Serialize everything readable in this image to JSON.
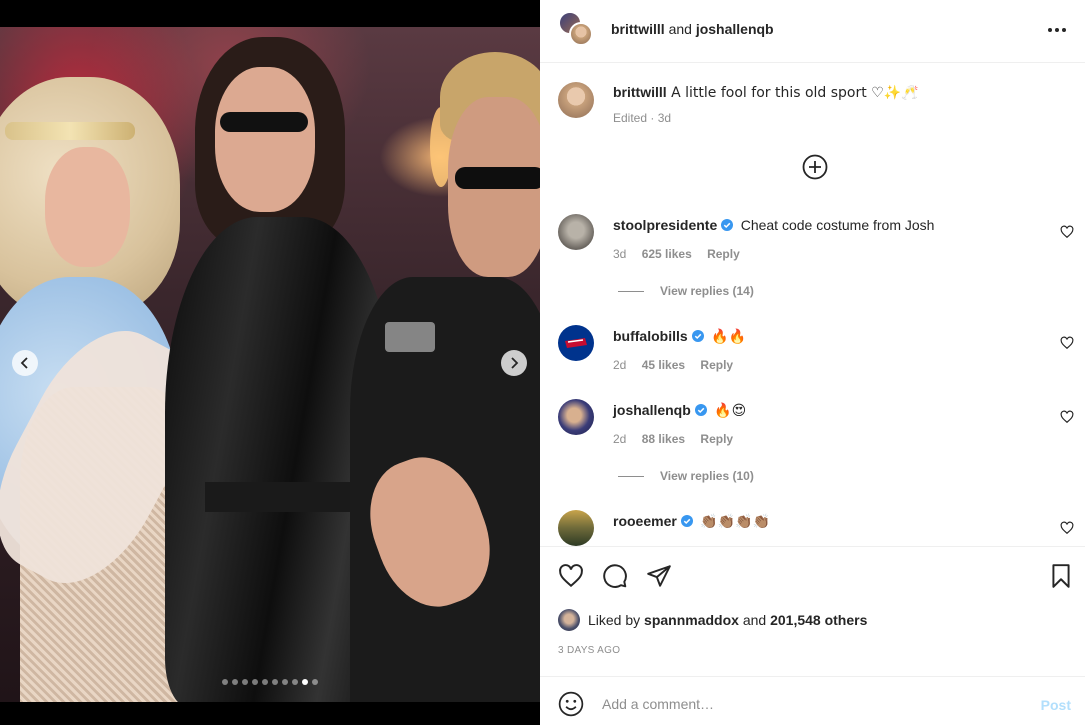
{
  "media": {
    "carousel": {
      "total": 10,
      "active_index": 8
    }
  },
  "header": {
    "user1": "brittwilll",
    "joiner": "and",
    "user2": "joshallenqb"
  },
  "caption": {
    "username": "brittwilll",
    "text": "A little fool for this old sport ♡✨🥂",
    "meta": "Edited · 3d"
  },
  "comments": [
    {
      "username": "stoolpresidente",
      "verified": true,
      "text": "Cheat code costume from Josh",
      "time": "3d",
      "likes": "625 likes",
      "reply": "Reply",
      "view_replies": "View replies (14)"
    },
    {
      "username": "buffalobills",
      "verified": true,
      "text": "🔥🔥",
      "time": "2d",
      "likes": "45 likes",
      "reply": "Reply"
    },
    {
      "username": "joshallenqb",
      "verified": true,
      "text": "🔥😍",
      "time": "2d",
      "likes": "88 likes",
      "reply": "Reply",
      "view_replies": "View replies (10)"
    },
    {
      "username": "rooeemer",
      "verified": true,
      "text": "👏🏽👏🏽👏🏽👏🏽"
    }
  ],
  "likes": {
    "prefix": "Liked by",
    "user": "spannmaddox",
    "joiner": "and",
    "others": "201,548 others"
  },
  "date": "3 DAYS AGO",
  "comment_box": {
    "placeholder": "Add a comment…",
    "post_label": "Post"
  },
  "colors": {
    "verified": "#3897f0",
    "post_disabled": "#b2dffc",
    "bills_blue": "#00338d"
  },
  "icons": [
    "more-icon",
    "plus-circle-icon",
    "heart-icon",
    "comment-icon",
    "share-icon",
    "bookmark-icon",
    "emoji-icon",
    "chevron-left-icon",
    "chevron-right-icon",
    "verified-icon"
  ]
}
